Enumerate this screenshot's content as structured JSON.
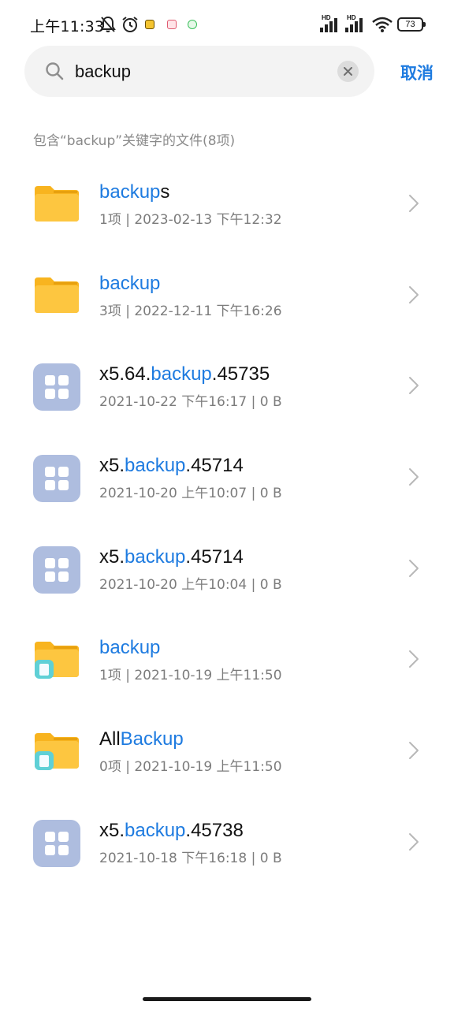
{
  "status_bar": {
    "time": "上午11:33",
    "hd1": "HD",
    "hd2": "HD",
    "battery": "73"
  },
  "search": {
    "query": "backup",
    "placeholder": "",
    "cancel_label": "取消"
  },
  "result_count": "包含“backup”关键字的文件(8项)",
  "files": [
    {
      "pre": "",
      "hl": "backup",
      "post": "s",
      "meta": "1项 | 2023-02-13 下午12:32",
      "icon": "folder-icon"
    },
    {
      "pre": "",
      "hl": "backup",
      "post": "",
      "meta": "3项 | 2022-12-11 下午16:26",
      "icon": "folder-icon"
    },
    {
      "pre": "x5.64.",
      "hl": "backup",
      "post": ".45735",
      "meta": "2021-10-22 下午16:17 | 0 B",
      "icon": "app-file-icon"
    },
    {
      "pre": "x5.",
      "hl": "backup",
      "post": ".45714",
      "meta": "2021-10-20 上午10:07 | 0 B",
      "icon": "app-file-icon"
    },
    {
      "pre": "x5.",
      "hl": "backup",
      "post": ".45714",
      "meta": "2021-10-20 上午10:04 | 0 B",
      "icon": "app-file-icon"
    },
    {
      "pre": "",
      "hl": "backup",
      "post": "",
      "meta": "1项 | 2021-10-19 上午11:50",
      "icon": "app-folder-icon"
    },
    {
      "pre": "All",
      "hl": "Backup",
      "post": "",
      "meta": "0项 | 2021-10-19 上午11:50",
      "icon": "app-folder-icon"
    },
    {
      "pre": "x5.",
      "hl": "backup",
      "post": ".45738",
      "meta": "2021-10-18 下午16:18 | 0 B",
      "icon": "app-file-icon"
    }
  ],
  "colors": {
    "accent": "#1e7be0",
    "folder": "#fdbf2d",
    "app_tile": "#aebddf"
  }
}
